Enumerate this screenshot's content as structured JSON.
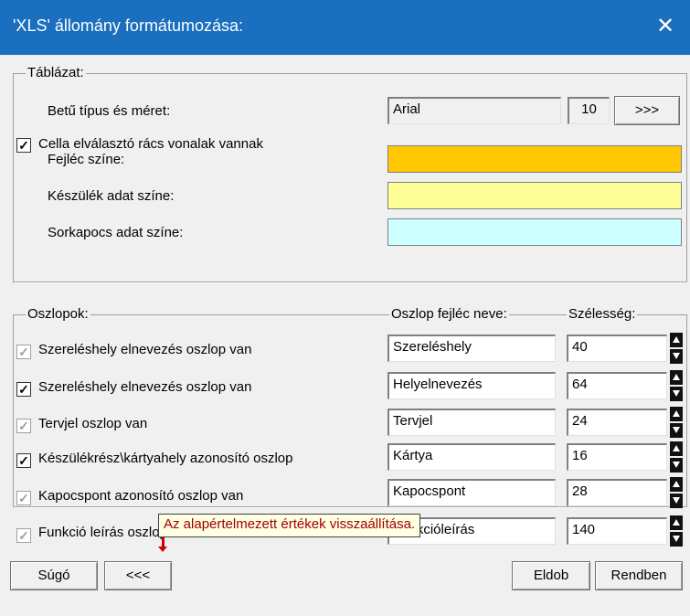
{
  "window": {
    "title": "'XLS' állomány formátumozása:"
  },
  "table_group": {
    "label": "Táblázat:",
    "font_label": "Betű típus és méret:",
    "font_name": "Arial",
    "font_size": "10",
    "font_button": ">>>",
    "grid_checkbox_label": "Cella elválasztó rács vonalak vannak",
    "grid_checked": true,
    "header_color_label": "Fejléc színe:",
    "header_color": "#ffc800",
    "device_color_label": "Készülék adat színe:",
    "device_color": "#ffff99",
    "terminal_color_label": "Sorkapocs adat színe:",
    "terminal_color": "#ccffff"
  },
  "columns_group": {
    "label": "Oszlopok:",
    "header_name_col": "Oszlop fejléc neve:",
    "width_col": "Szélesség:",
    "rows": [
      {
        "label": "Szereléshely elnevezés oszlop van",
        "checked": true,
        "disabled": true,
        "header": "Szereléshely",
        "width": "40"
      },
      {
        "label": "Szereléshely elnevezés oszlop van",
        "checked": true,
        "disabled": false,
        "header": "Helyelnevezés",
        "width": "64"
      },
      {
        "label": "Tervjel oszlop van",
        "checked": true,
        "disabled": true,
        "header": "Tervjel",
        "width": "24"
      },
      {
        "label": "Készülékrész\\kártyahely azonosító oszlop",
        "checked": true,
        "disabled": false,
        "header": "Kártya",
        "width": "16"
      },
      {
        "label": "Kapocspont azonosító oszlop van",
        "checked": true,
        "disabled": true,
        "header": "Kapocspont",
        "width": "28"
      },
      {
        "label": "Funkció leírás oszlop van",
        "checked": true,
        "disabled": true,
        "header": "Funkcióleírás",
        "width": "140"
      }
    ]
  },
  "footer": {
    "help_button": "Súgó",
    "reset_button": "<<<",
    "tooltip": "Az alapértelmezett értékek visszaállítása.",
    "discard_button": "Eldob",
    "ok_button": "Rendben"
  }
}
